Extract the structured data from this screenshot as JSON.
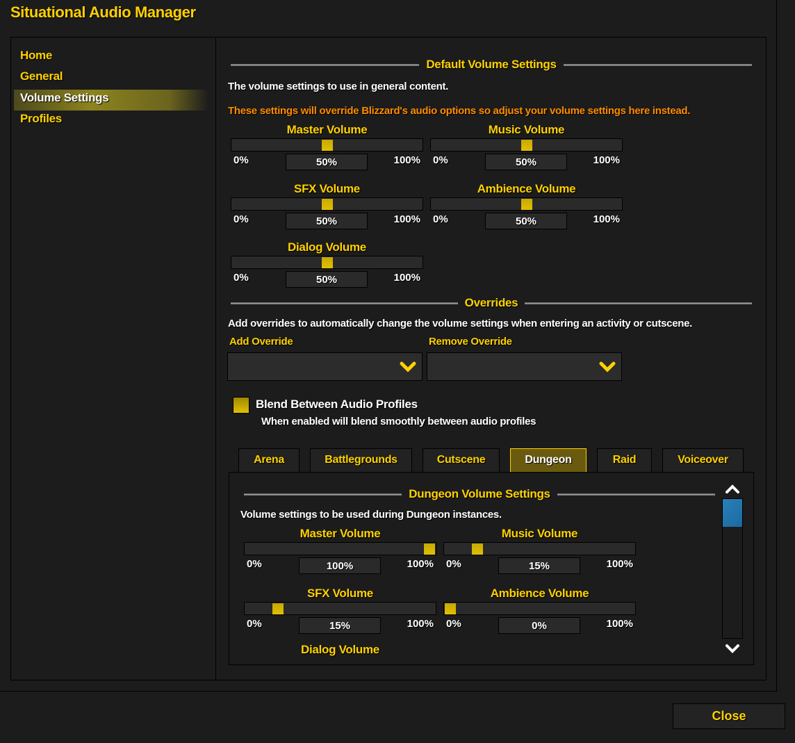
{
  "window": {
    "title": "Situational Audio Manager",
    "close_label": "Close"
  },
  "sidebar": {
    "items": [
      {
        "label": "Home"
      },
      {
        "label": "General"
      },
      {
        "label": "Volume Settings",
        "selected": true
      },
      {
        "label": "Profiles"
      }
    ]
  },
  "defaults": {
    "header": "Default Volume Settings",
    "description": "The volume settings to use in general content.",
    "warning": "These settings will override Blizzard's audio options so adjust your volume settings here instead.",
    "sliders": [
      {
        "label": "Master Volume",
        "value": 50,
        "value_text": "50%",
        "min_label": "0%",
        "max_label": "100%"
      },
      {
        "label": "Music Volume",
        "value": 50,
        "value_text": "50%",
        "min_label": "0%",
        "max_label": "100%"
      },
      {
        "label": "SFX Volume",
        "value": 50,
        "value_text": "50%",
        "min_label": "0%",
        "max_label": "100%"
      },
      {
        "label": "Ambience Volume",
        "value": 50,
        "value_text": "50%",
        "min_label": "0%",
        "max_label": "100%"
      },
      {
        "label": "Dialog Volume",
        "value": 50,
        "value_text": "50%",
        "min_label": "0%",
        "max_label": "100%"
      }
    ]
  },
  "overrides": {
    "header": "Overrides",
    "description": "Add overrides to automatically change the volume settings when entering an activity or cutscene.",
    "add_label": "Add Override",
    "add_value": "",
    "remove_label": "Remove Override",
    "remove_value": "",
    "blend_label": "Blend Between Audio Profiles",
    "blend_checked": true,
    "blend_description": "When enabled will blend smoothly between audio profiles"
  },
  "tabs": [
    {
      "label": "Arena"
    },
    {
      "label": "Battlegrounds"
    },
    {
      "label": "Cutscene"
    },
    {
      "label": "Dungeon",
      "selected": true
    },
    {
      "label": "Raid"
    },
    {
      "label": "Voiceover"
    }
  ],
  "dungeon": {
    "header": "Dungeon Volume Settings",
    "description": "Volume settings to be used during Dungeon instances.",
    "sliders": [
      {
        "label": "Master Volume",
        "value": 100,
        "value_text": "100%",
        "min_label": "0%",
        "max_label": "100%"
      },
      {
        "label": "Music Volume",
        "value": 15,
        "value_text": "15%",
        "min_label": "0%",
        "max_label": "100%"
      },
      {
        "label": "SFX Volume",
        "value": 15,
        "value_text": "15%",
        "min_label": "0%",
        "max_label": "100%"
      },
      {
        "label": "Ambience Volume",
        "value": 0,
        "value_text": "0%",
        "min_label": "0%",
        "max_label": "100%"
      }
    ],
    "dialog_label": "Dialog Volume",
    "scrollbar_position": 0
  },
  "colors": {
    "accent": "#ffd100",
    "warning": "#ff8c00",
    "scroll_thumb": "#1e73a8",
    "background": "#1c1c1c"
  }
}
